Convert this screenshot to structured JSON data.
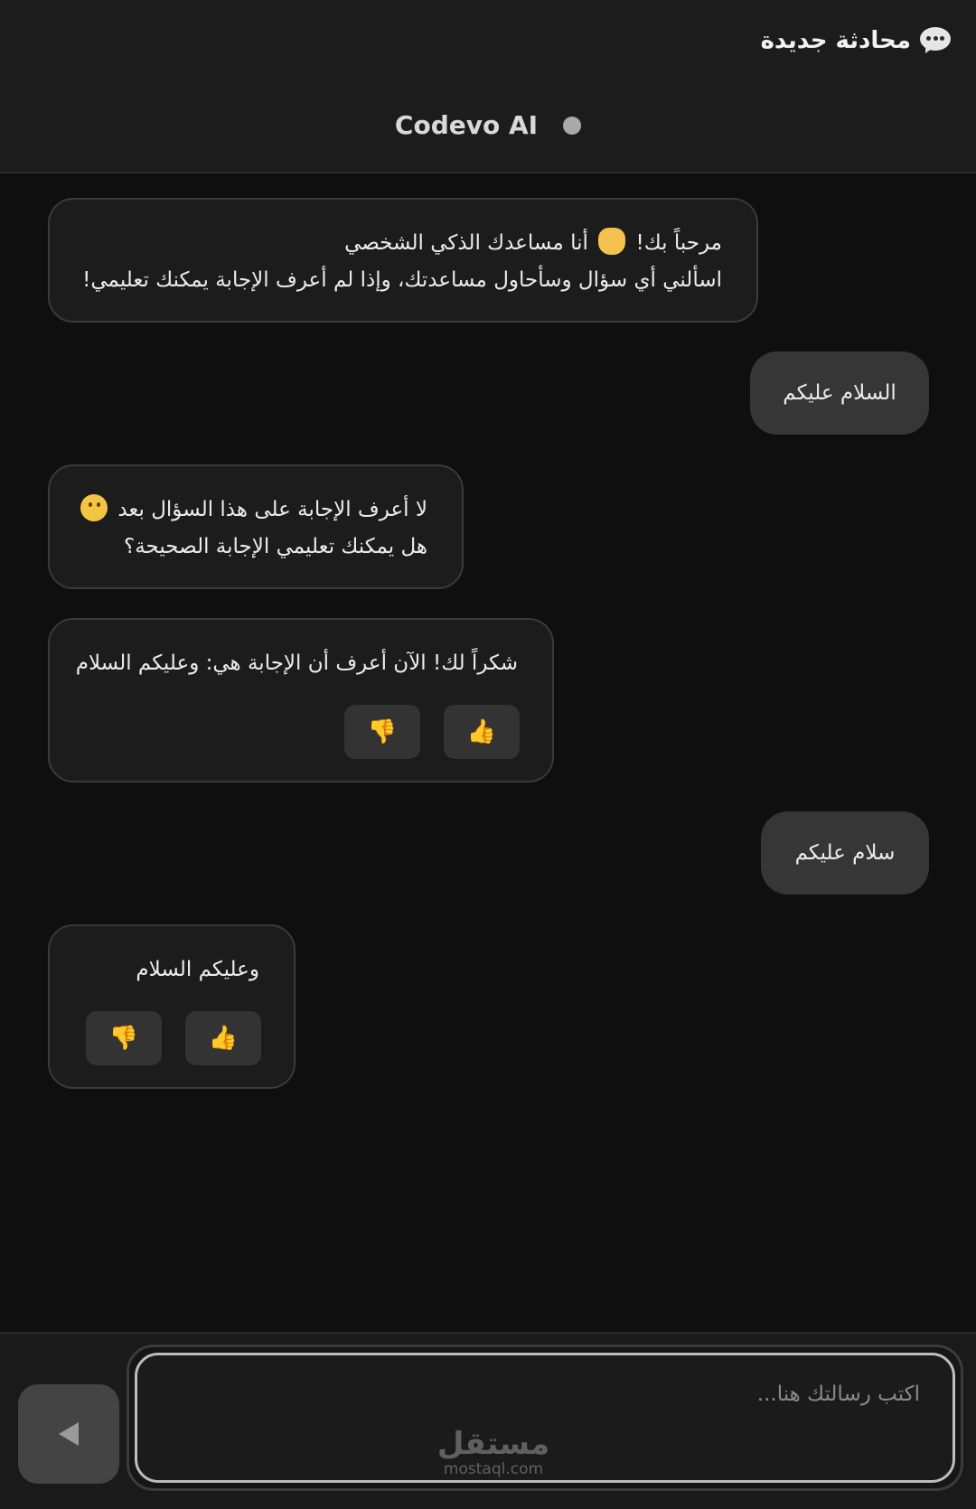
{
  "header": {
    "new_chat_label": "محادثة جديدة",
    "new_chat_icon": "chat-bubble-icon",
    "brand_name": "Codevo AI",
    "status_color": "#a9a9a9"
  },
  "messages": [
    {
      "role": "bot",
      "lines": [
        "مرحباً بك!",
        "أنا مساعدك الذكي الشخصي",
        "اسألني أي سؤال وسأحاول مساعدتك، وإذا لم أعرف الإجابة يمكنك تعليمي!"
      ]
    },
    {
      "role": "user",
      "text": "السلام عليكم"
    },
    {
      "role": "bot",
      "lines": [
        "لا أعرف الإجابة على هذا السؤال بعد",
        "هل يمكنك تعليمي الإجابة الصحيحة؟"
      ]
    },
    {
      "role": "bot",
      "text": "شكراً لك! الآن أعرف أن الإجابة هي: وعليكم السلام",
      "feedback": {
        "like": "👍",
        "dislike": "👎"
      }
    },
    {
      "role": "user",
      "text": "سلام عليكم"
    },
    {
      "role": "bot",
      "text": "وعليكم السلام",
      "feedback": {
        "like": "👍",
        "dislike": "👎"
      }
    }
  ],
  "composer": {
    "placeholder": "اكتب رسالتك هنا...",
    "send_icon": "send-arrow-icon"
  },
  "watermark": {
    "logo": "مستقل",
    "url": "mostaql.com"
  },
  "colors": {
    "background": "#0f0f0f",
    "header": "#1c1c1c",
    "bot_bubble": "#1c1c1c",
    "user_bubble": "#363636",
    "feedback_button": "#333333"
  }
}
